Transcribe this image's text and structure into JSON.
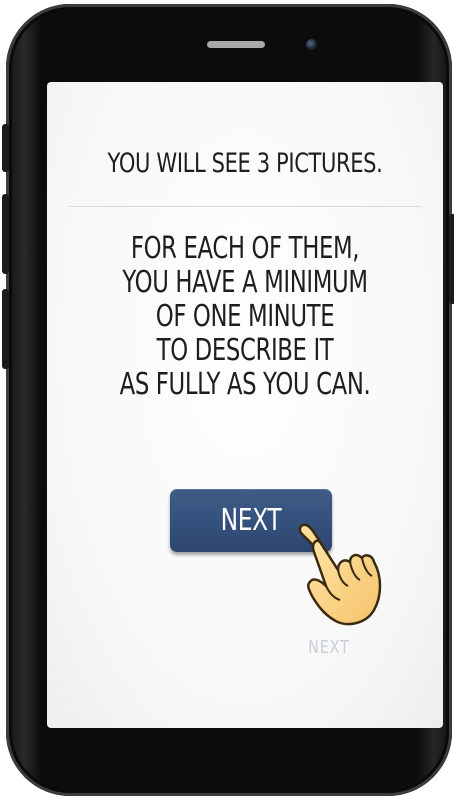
{
  "screen": {
    "title": "YOU WILL SEE 3 PICTURES.",
    "instructions": [
      "FOR EACH OF THEM,",
      "YOU HAVE A MINIMUM",
      "OF ONE MINUTE",
      "TO DESCRIBE IT",
      "AS FULLY AS YOU CAN."
    ],
    "next_button_label": "NEXT",
    "faded_next_label": "NEXT"
  },
  "icons": {
    "pointer": "pointing-hand-icon"
  },
  "colors": {
    "button": "#34507c",
    "button_text": "#ffffff",
    "text": "#1e1e1e",
    "phone_body": "#0c0c0c",
    "faded_label": "#c8d0db"
  }
}
